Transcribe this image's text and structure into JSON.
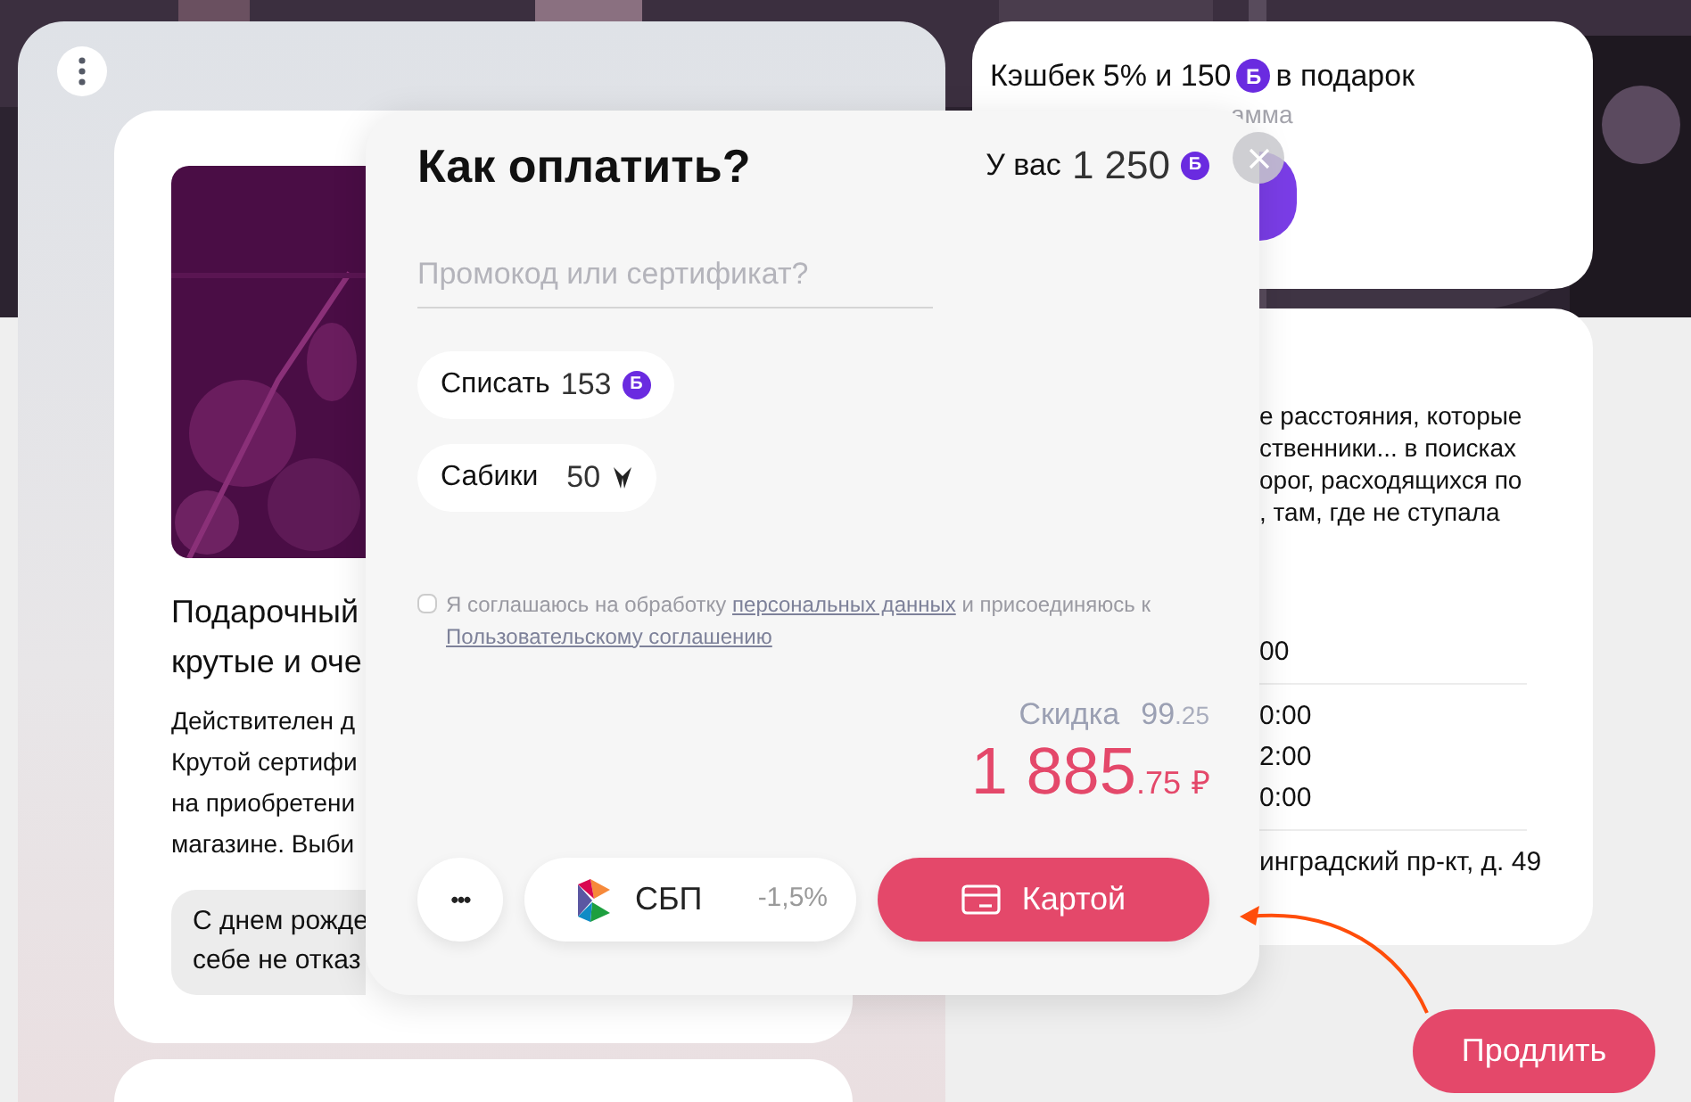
{
  "product_card": {
    "title_lines": [
      "Подарочный",
      "крутые и оче"
    ],
    "description_lines": [
      "Действителен д",
      "Крутой сертифи",
      "на приобретени",
      "магазине. Выби"
    ],
    "greeting_lines": [
      "С днем рожде",
      "себе не отказ"
    ]
  },
  "cashback_card": {
    "text_before": "Кэшбек 5% и 150",
    "coin": "Б",
    "text_after": "в подарок",
    "hint_fragment": "амма"
  },
  "info_card": {
    "description_lines": [
      "е расстояния, которые",
      "ственники... в поисках",
      "орог, расходящихся по",
      ", там, где не ступала"
    ],
    "hours_lines": [
      "00"
    ],
    "schedule_lines": [
      "0:00",
      "2:00",
      "0:00"
    ],
    "address": "инградский пр-кт, д. 49"
  },
  "payment_modal": {
    "title": "Как оплатить?",
    "balance_label": "У вас",
    "balance": "1 250",
    "balance_coin": "Б",
    "promo_placeholder": "Промокод или сертификат?",
    "chips": [
      {
        "kind": "bonus",
        "label": "Списать",
        "value": "153",
        "coin": "Б"
      },
      {
        "kind": "dropdown",
        "label": "Сабики",
        "value": "50"
      }
    ],
    "consent": {
      "checked": false,
      "parts": [
        {
          "text": "Я соглашаюсь на обработку ",
          "link": false
        },
        {
          "text": "персональных данных",
          "link": true
        },
        {
          "text": " и присоединяюсь  к ",
          "link": false
        },
        {
          "text": "Пользовательскому соглашению",
          "link": true
        }
      ]
    },
    "discount": {
      "label": "Скидка",
      "amount": "99",
      "fraction": ".25"
    },
    "total": {
      "amount": "1 885",
      "fraction": ".75",
      "currency": "₽"
    },
    "more_button": "•••",
    "methods": [
      {
        "kind": "sbp",
        "label": "СБП",
        "note": "-1,5%",
        "selected": false
      },
      {
        "kind": "card",
        "label": "Картой",
        "selected": true
      }
    ]
  },
  "renew_button": "Продлить"
}
